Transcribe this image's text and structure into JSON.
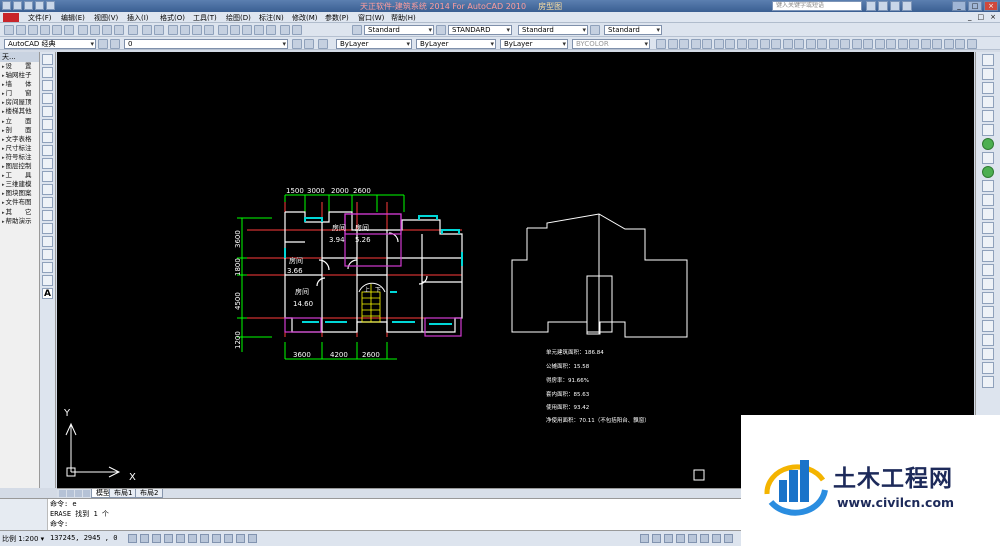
{
  "titlebar": {
    "title": "天正软件-建筑系统 2014 For AutoCAD 2010",
    "file": "房型图",
    "search_placeholder": "键入关键字或短语"
  },
  "menubar": {
    "items": [
      "文件(F)",
      "编辑(E)",
      "视图(V)",
      "插入(I)",
      "格式(O)",
      "工具(T)",
      "绘图(D)",
      "标注(N)",
      "修改(M)",
      "参数(P)",
      "窗口(W)",
      "帮助(H)"
    ],
    "controls": [
      "_",
      "□",
      "×"
    ]
  },
  "toolbar": {
    "workspace": "AutoCAD 经典",
    "text_style": "Standard",
    "dim_style": "STANDARD",
    "table_style": "Standard",
    "mleader_style": "Standard",
    "layer_value": "0",
    "color": "ByLayer",
    "linetype": "ByLayer",
    "lineweight": "ByLayer",
    "plotstyle": "BYCOLOR"
  },
  "leftpanel": {
    "header": "天...",
    "items": [
      "设　　置",
      "轴网柱子",
      "墙　　体",
      "门　　窗",
      "房间屋顶",
      "楼梯其他",
      "立　　面",
      "剖　　面",
      "文字表格",
      "尺寸标注",
      "符号标注",
      "图层控制",
      "工　　具",
      "三维建模",
      "图块图案",
      "文件布图",
      "其　　它",
      "帮助演示"
    ]
  },
  "drawing": {
    "top_dims": [
      "1500",
      "3000",
      "2000",
      "2600"
    ],
    "bottom_dims": [
      "3600",
      "4200",
      "2600"
    ],
    "left_dims": [
      "3600",
      "1800",
      "4500",
      "1200"
    ],
    "rooms": [
      {
        "name": "房间",
        "area": "3.94"
      },
      {
        "name": "房间",
        "area": "5.26"
      },
      {
        "name": "房间",
        "area": "3.66"
      },
      {
        "name": "房间",
        "area": "14.60"
      }
    ],
    "stair_labels": [
      "上",
      "下"
    ],
    "stats": [
      "单元建筑面积：186.84",
      "公摊面积：15.58",
      "得房率：91.66%",
      "套内面积：85.63",
      "使用面积：93.42",
      "净使用面积：70.11（不包括阳台、飘窗）"
    ],
    "ucs_x": "X",
    "ucs_y": "Y"
  },
  "tabs": [
    "模型",
    "布局1",
    "布局2"
  ],
  "command": {
    "lines": [
      "命令: e",
      "ERASE 找到 1 个",
      "命令:"
    ]
  },
  "status": {
    "scale": "比例 1:200 ▾",
    "coords": "137245, 2945 , 0"
  },
  "watermark": {
    "brand": "土木工程网",
    "url": "www.civilcn.com"
  },
  "colors": {
    "canvas": "#000000",
    "wall": "#ffffff",
    "dim": "#00ff00",
    "axis": "#ff3b3b",
    "window": "#00d7d7",
    "door": "#d13bd1",
    "stair": "#ffff00",
    "text": "#ffffff"
  }
}
